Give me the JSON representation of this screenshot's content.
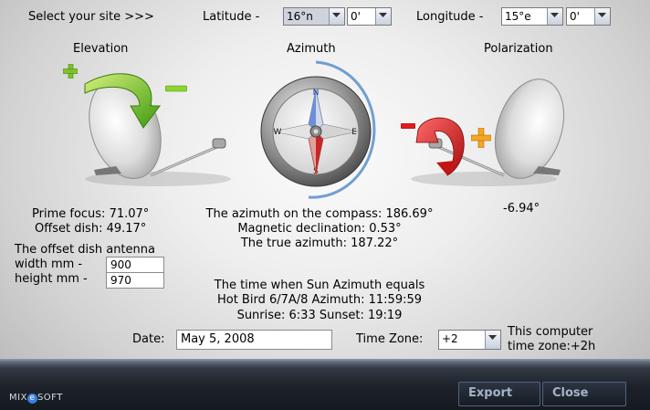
{
  "site": {
    "select_label": "Select your site >>>",
    "latitude_label": "Latitude -",
    "latitude_deg": "16°n",
    "latitude_min": "0'",
    "longitude_label": "Longitude -",
    "longitude_deg": "15°e",
    "longitude_min": "0'"
  },
  "elevation": {
    "title": "Elevation",
    "prime_focus": "Prime focus: 71.07°",
    "offset_dish": "Offset dish: 49.17°",
    "plus_color": "#7ec12c",
    "minus_color": "#8cd42f"
  },
  "azimuth": {
    "title": "Azimuth",
    "compass_text": "The azimuth on the compass: 186.69°",
    "magnetic_declination": "Magnetic declination: 0.53°",
    "true_azimuth": "The true azimuth: 187.22°",
    "compass_letters": {
      "n": "N",
      "e": "E",
      "s": "S",
      "w": "W"
    }
  },
  "polarization": {
    "title": "Polarization",
    "value": "-6.94°",
    "arrow_color": "#d81a1a",
    "plus_color": "#f5a623",
    "minus_color": "#e01d1d"
  },
  "antenna": {
    "heading": "The offset dish antenna",
    "width_label": "width  mm -",
    "width_value": "900",
    "height_label": "height mm -",
    "height_value": "970"
  },
  "sun": {
    "line1": "The time when Sun Azimuth equals",
    "line2": "Hot Bird 6/7A/8 Azimuth: 11:59:59",
    "line3": "Sunrise: 6:33  Sunset: 19:19"
  },
  "date": {
    "label": "Date:",
    "value": "May 5, 2008"
  },
  "timezone": {
    "label": "Time Zone:",
    "value": "+2",
    "note_line1": "This computer",
    "note_line2": "time zone:+2h"
  },
  "buttons": {
    "export": "Export",
    "close": "Close"
  },
  "logo": {
    "part1": "MIX",
    "part2": "e",
    "part3": "SOFT"
  },
  "colors": {
    "accent_arc": "#5b8fc9",
    "bar_text": "#a6b3c6"
  }
}
